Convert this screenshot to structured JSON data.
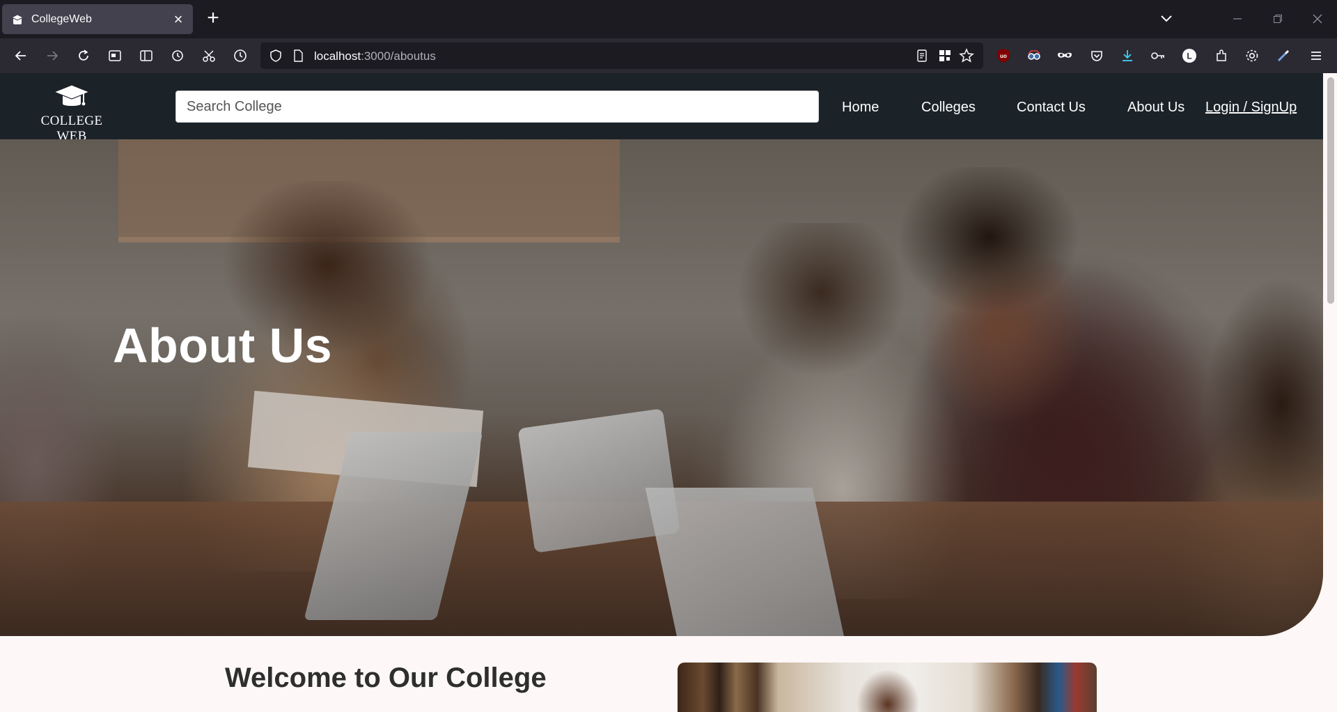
{
  "browser": {
    "tab_title": "CollegeWeb",
    "url_host": "localhost",
    "url_path": ":3000/aboutus"
  },
  "navbar": {
    "logo_text": "COLLEGE WEB",
    "search_placeholder": "Search College",
    "links": {
      "home": "Home",
      "colleges": "Colleges",
      "contact": "Contact Us",
      "about": "About Us",
      "login": "Login",
      "separator": " / ",
      "signup": "SignUp"
    }
  },
  "hero": {
    "title": "About Us"
  },
  "welcome": {
    "heading": "Welcome to Our College"
  },
  "colors": {
    "navbar_bg": "#1b2228",
    "page_bg": "#fdf8f7",
    "browser_toolbar": "#2b2a33"
  }
}
